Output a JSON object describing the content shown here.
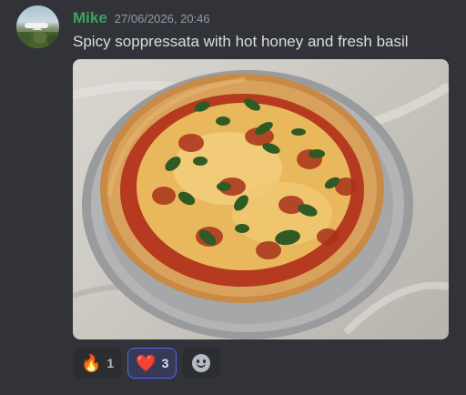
{
  "message": {
    "author": "Mike",
    "timestamp": "27/06/2026, 20:46",
    "text": "Spicy soppressata with hot honey and fresh basil",
    "author_color": "#3ba55d"
  },
  "attachment": {
    "kind": "image",
    "subject": "pizza-on-metal-tray"
  },
  "reactions": [
    {
      "emoji": "🔥",
      "count": "1",
      "active": false
    },
    {
      "emoji": "❤️",
      "count": "3",
      "active": true
    }
  ],
  "add_reaction_icon": "smiley-add-reaction-icon",
  "colors": {
    "background": "#313338",
    "accent": "#5865f2",
    "timestamp": "#949ba4"
  }
}
